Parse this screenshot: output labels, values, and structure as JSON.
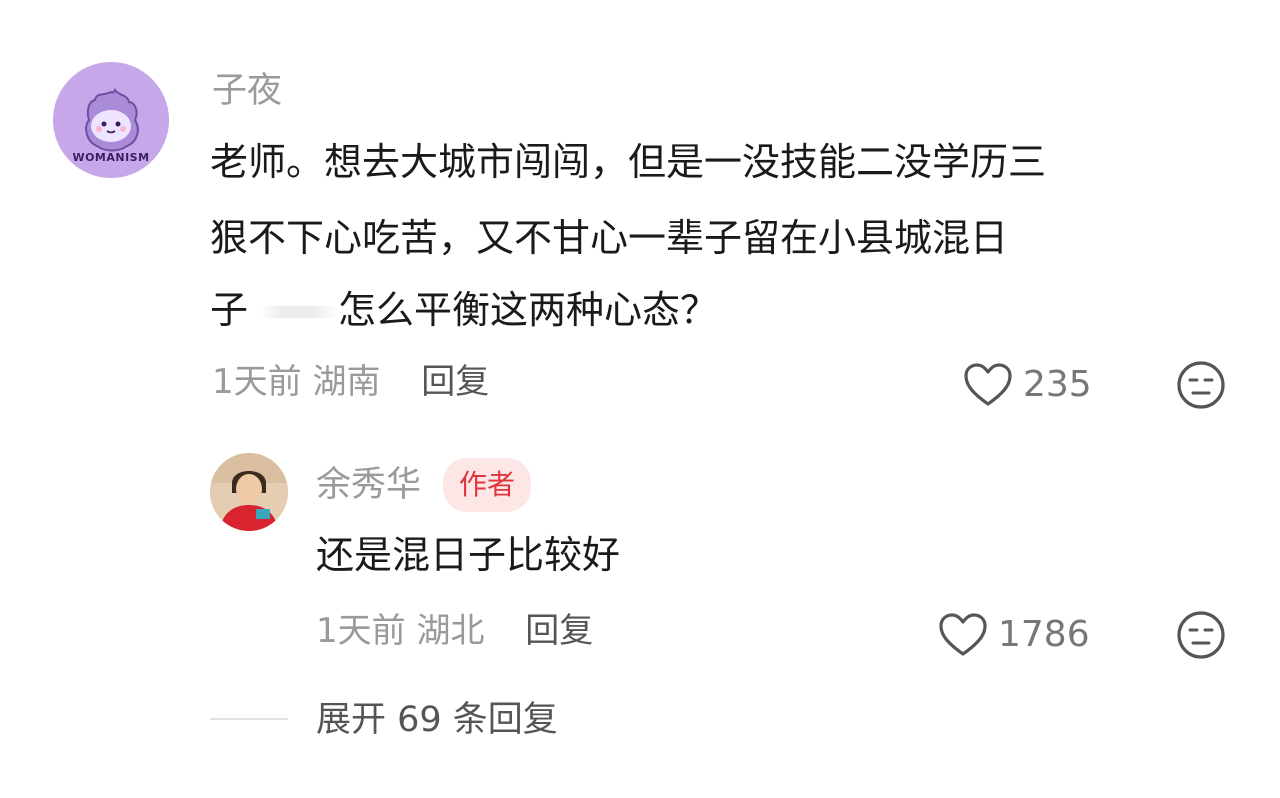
{
  "comment": {
    "username": "子夜",
    "avatar_brand": "WOMANISM",
    "text_lines": [
      "老师。想去大城市闯闯，但是一没技能二没学历三",
      "狠不下心吃苦，又不甘心一辈子留在小县城混日",
      "子",
      "怎么平衡这两种心态？"
    ],
    "time": "1天前",
    "location": "湖南",
    "reply_label": "回复",
    "likes": "235",
    "like_icon": "heart-outline-icon",
    "dislike_icon": "neutral-face-icon"
  },
  "reply": {
    "username": "余秀华",
    "badge": "作者",
    "text": "还是混日子比较好",
    "time": "1天前",
    "location": "湖北",
    "reply_label": "回复",
    "likes": "1786"
  },
  "expand": {
    "label": "展开 69 条回复"
  },
  "colors": {
    "avatar_bg": "#c6a7ea",
    "badge_bg": "#fde6e6",
    "badge_text": "#e0343f",
    "meta_text": "#9a9a9a"
  }
}
